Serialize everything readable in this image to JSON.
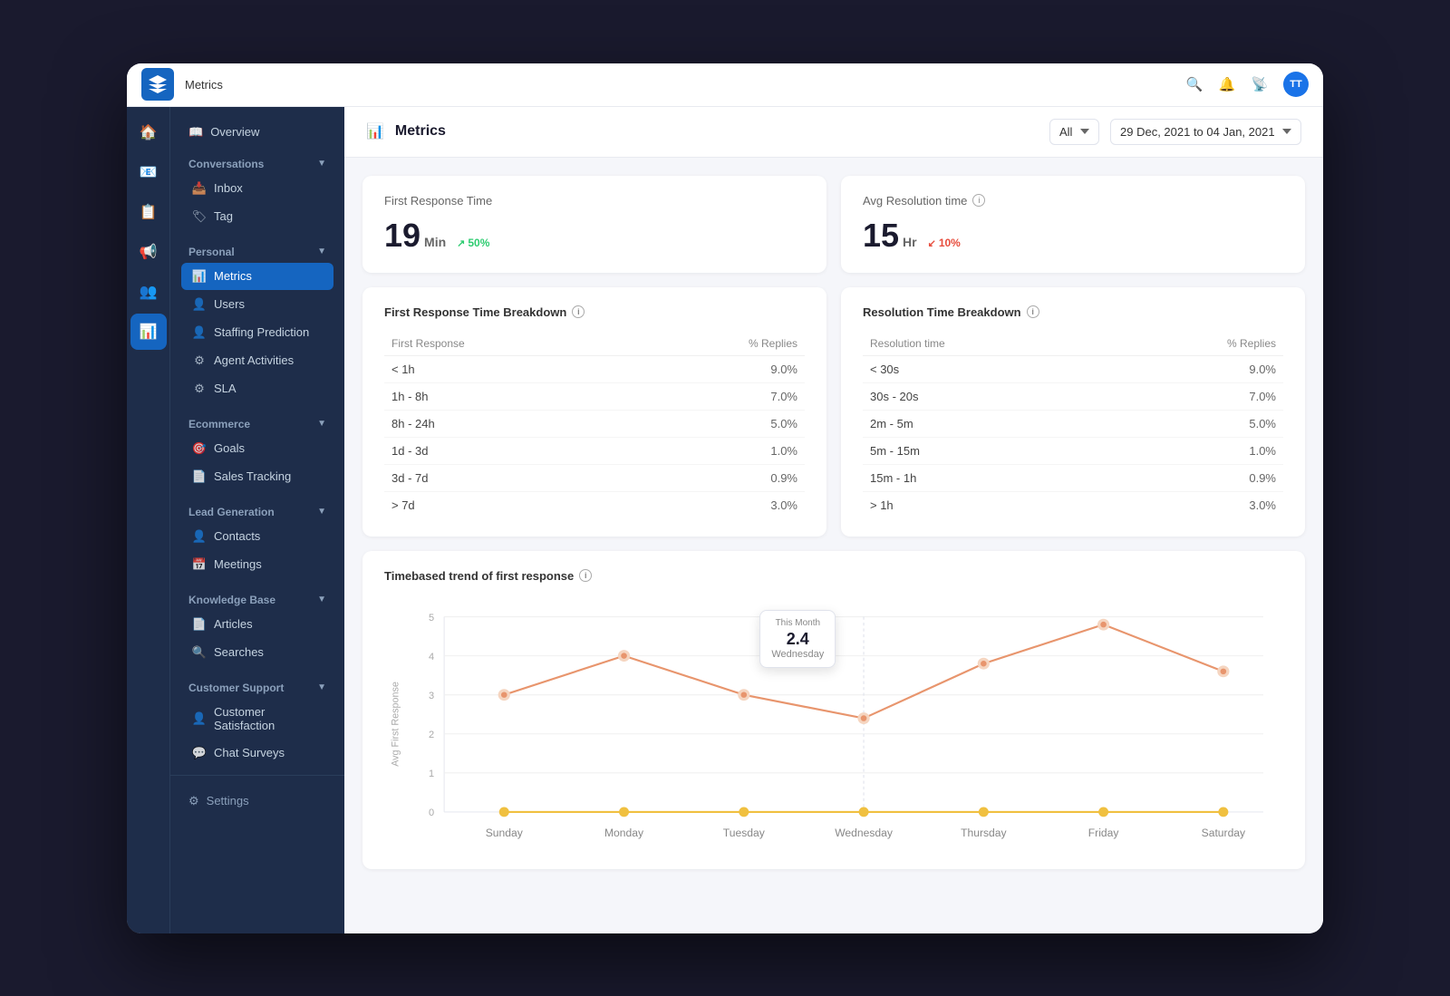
{
  "app": {
    "title": "Metrics",
    "user_initials": "TT"
  },
  "sidebar": {
    "overview_label": "Overview",
    "sections": [
      {
        "title": "Conversations",
        "items": [
          {
            "label": "Inbox",
            "icon": "inbox"
          },
          {
            "label": "Tag",
            "icon": "tag"
          }
        ]
      },
      {
        "title": "Personal",
        "items": [
          {
            "label": "Metrics",
            "icon": "chart",
            "active": true
          },
          {
            "label": "Users",
            "icon": "users"
          },
          {
            "label": "Staffing Prediction",
            "icon": "staffing"
          },
          {
            "label": "Agent Activities",
            "icon": "agent"
          },
          {
            "label": "SLA",
            "icon": "sla"
          }
        ]
      },
      {
        "title": "Ecommerce",
        "items": [
          {
            "label": "Goals",
            "icon": "goals"
          },
          {
            "label": "Sales Tracking",
            "icon": "sales"
          }
        ]
      },
      {
        "title": "Lead Generation",
        "items": [
          {
            "label": "Contacts",
            "icon": "contacts"
          },
          {
            "label": "Meetings",
            "icon": "meetings"
          }
        ]
      },
      {
        "title": "Knowledge Base",
        "items": [
          {
            "label": "Articles",
            "icon": "articles"
          },
          {
            "label": "Searches",
            "icon": "searches"
          }
        ]
      },
      {
        "title": "Customer Support",
        "items": [
          {
            "label": "Customer Satisfaction",
            "icon": "satisfaction"
          },
          {
            "label": "Chat Surveys",
            "icon": "surveys"
          }
        ]
      }
    ]
  },
  "header": {
    "page_title": "Metrics",
    "filter_all": "All",
    "date_range": "29 Dec, 2021 to 04 Jan, 2021"
  },
  "metrics": {
    "first_response": {
      "title": "First Response Time",
      "value": "19",
      "unit": "Min",
      "badge_value": "50%",
      "badge_direction": "up"
    },
    "avg_resolution": {
      "title": "Avg Resolution time",
      "value": "15",
      "unit": "Hr",
      "badge_value": "10%",
      "badge_direction": "down"
    }
  },
  "breakdown": {
    "first_response": {
      "title": "First Response Time Breakdown",
      "col1": "First Response",
      "col2": "% Replies",
      "rows": [
        {
          "range": "< 1h",
          "value": "9.0%"
        },
        {
          "range": "1h - 8h",
          "value": "7.0%"
        },
        {
          "range": "8h - 24h",
          "value": "5.0%"
        },
        {
          "range": "1d - 3d",
          "value": "1.0%"
        },
        {
          "range": "3d - 7d",
          "value": "0.9%"
        },
        {
          "range": "> 7d",
          "value": "3.0%"
        }
      ]
    },
    "resolution_time": {
      "title": "Resolution Time Breakdown",
      "col1": "Resolution time",
      "col2": "% Replies",
      "rows": [
        {
          "range": "< 30s",
          "value": "9.0%"
        },
        {
          "range": "30s - 20s",
          "value": "7.0%"
        },
        {
          "range": "2m - 5m",
          "value": "5.0%"
        },
        {
          "range": "5m - 15m",
          "value": "1.0%"
        },
        {
          "range": "15m - 1h",
          "value": "0.9%"
        },
        {
          "range": "> 1h",
          "value": "3.0%"
        }
      ]
    }
  },
  "chart": {
    "title": "Timebased trend of first response",
    "y_label": "Avg First Response",
    "x_labels": [
      "Sunday",
      "Monday",
      "Tuesday",
      "Wednesday",
      "Thursday",
      "Friday",
      "Saturday"
    ],
    "y_ticks": [
      "0",
      "1",
      "2",
      "3",
      "4",
      "5"
    ],
    "orange_points": [
      3,
      4,
      3,
      2.4,
      3.8,
      4.8,
      3.6
    ],
    "yellow_points": [
      0,
      0,
      0,
      0,
      0,
      0,
      0
    ],
    "tooltip": {
      "label": "This Month",
      "value": "2.4",
      "day": "Wednesday"
    }
  }
}
